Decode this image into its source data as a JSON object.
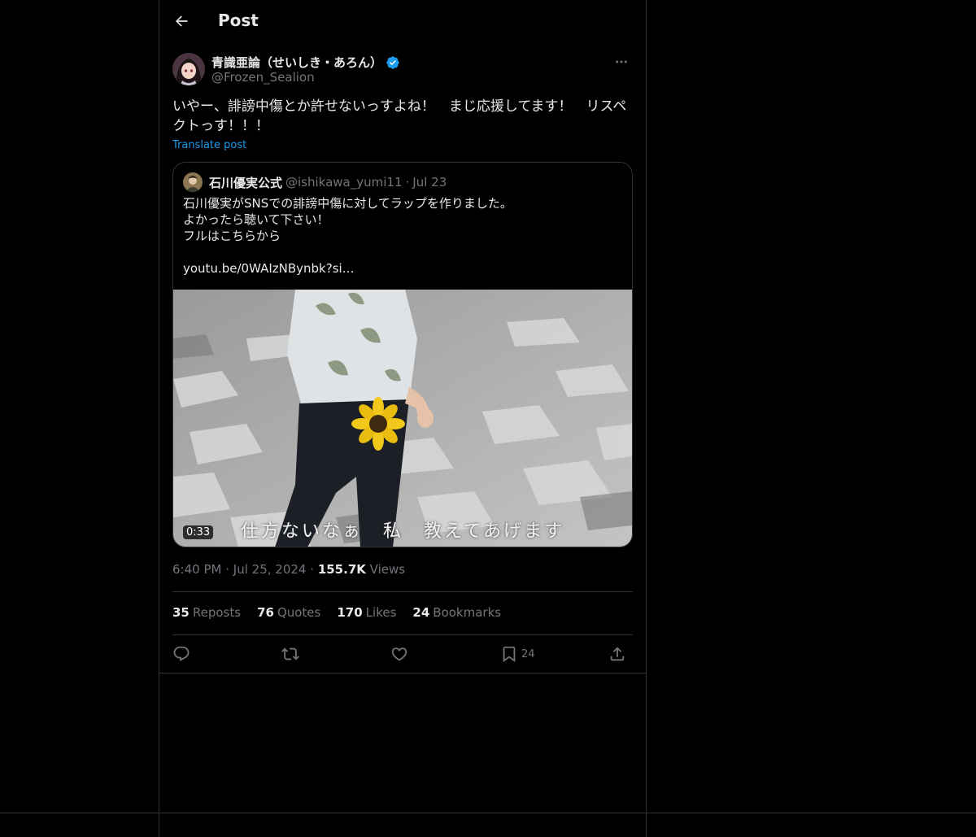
{
  "header": {
    "title": "Post"
  },
  "author": {
    "name": "青識亜論（せいしき・あろん）",
    "handle": "@Frozen_Sealion",
    "verified": true
  },
  "post": {
    "text": "いやー、誹謗中傷とか許せないっすよね！　まじ応援してます！　リスペクトっす！！！",
    "translate_label": "Translate post"
  },
  "quote": {
    "name": "石川優実公式",
    "handle": "@ishikawa_yumi11",
    "separator": "·",
    "date": "Jul 23",
    "lines": [
      "石川優実がSNSでの誹謗中傷に対してラップを作りました。",
      "よかったら聴いて下さい！",
      "フルはこちらから",
      "",
      "youtu.be/0WAIzNBynbk?si…"
    ],
    "video": {
      "duration": "0:33",
      "subtitle": "仕方ないなぁ　私　教えてあげます"
    }
  },
  "meta": {
    "time": "6:40 PM",
    "dot1": "·",
    "date": "Jul 25, 2024",
    "dot2": "·",
    "views_count": "155.7K",
    "views_label": "Views"
  },
  "stats": [
    {
      "count": "35",
      "label": "Reposts"
    },
    {
      "count": "76",
      "label": "Quotes"
    },
    {
      "count": "170",
      "label": "Likes"
    },
    {
      "count": "24",
      "label": "Bookmarks"
    }
  ],
  "actions": {
    "bookmark_count": "24"
  },
  "colors": {
    "background": "#000000",
    "text": "#e7e9ea",
    "secondary": "#71767b",
    "accent": "#1d9bf0",
    "border": "#2f3336"
  }
}
